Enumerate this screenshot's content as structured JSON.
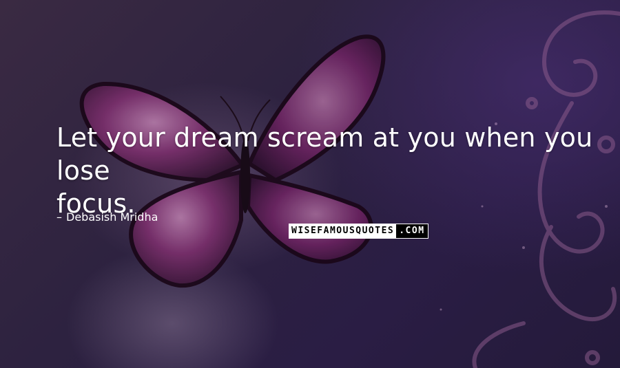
{
  "quote": {
    "line1": "Let your dream scream at you when you lose",
    "line2": "focus."
  },
  "author": {
    "dash": "–",
    "name": "Debasish Mridha"
  },
  "watermark": {
    "part1": "WISEFAMOUSQUOTES",
    "part2": ".COM"
  },
  "colors": {
    "background": "#2a1c3c",
    "butterfly_wing": "#6a2a5e",
    "text": "#ffffff"
  },
  "icons": [
    "butterfly-illustration",
    "swirl-ornament"
  ]
}
